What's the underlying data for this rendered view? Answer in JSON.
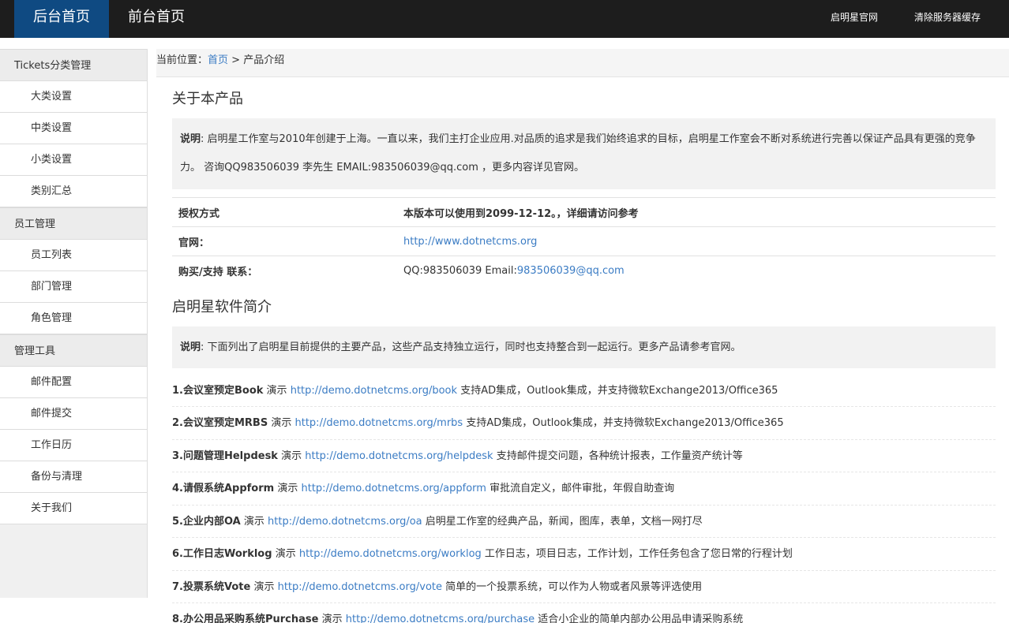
{
  "topbar": {
    "tabs": [
      {
        "label": "后台首页",
        "active": true
      },
      {
        "label": "前台首页",
        "active": false
      }
    ],
    "links": [
      {
        "label": "启明星官网"
      },
      {
        "label": "清除服务器缓存"
      }
    ]
  },
  "sidebar": {
    "groups": [
      {
        "title": "Tickets分类管理",
        "items": [
          "大类设置",
          "中类设置",
          "小类设置",
          "类别汇总"
        ]
      },
      {
        "title": "员工管理",
        "items": [
          "员工列表",
          "部门管理",
          "角色管理"
        ]
      },
      {
        "title": "管理工具",
        "items": [
          "邮件配置",
          "邮件提交",
          "工作日历",
          "备份与清理",
          "关于我们"
        ]
      }
    ]
  },
  "breadcrumb": {
    "prefix": "当前位置：",
    "home": "首页",
    "sep": " > ",
    "current": "产品介绍"
  },
  "about": {
    "title": "关于本产品",
    "note_label": "说明",
    "note_text": ": 启明星工作室与2010年创建于上海。一直以来，我们主打企业应用.对品质的追求是我们始终追求的目标，启明星工作室会不断对系统进行完善以保证产品具有更强的竞争力。 咨询QQ983506039 李先生 EMAIL:983506039@qq.com ，更多内容详见官网。"
  },
  "info": {
    "license_key": "授权方式",
    "license_value": "本版本可以使用到2099-12-12。，详细请访问参考",
    "site_key": "官网：",
    "site_value": "http://www.dotnetcms.org",
    "contact_key": "购买/支持 联系：",
    "contact_prefix": "QQ:983506039 Email:",
    "contact_email": "983506039@qq.com"
  },
  "intro": {
    "title": "启明星软件简介",
    "note_label": "说明",
    "note_text": ": 下面列出了启明星目前提供的主要产品，这些产品支持独立运行，同时也支持整合到一起运行。更多产品请参考官网。"
  },
  "demo_label": "演示",
  "products": [
    {
      "name": "1.会议室预定Book",
      "url": "http://demo.dotnetcms.org/book",
      "desc": "支持AD集成，Outlook集成，并支持微软Exchange2013/Office365"
    },
    {
      "name": "2.会议室预定MRBS",
      "url": "http://demo.dotnetcms.org/mrbs",
      "desc": "支持AD集成，Outlook集成，并支持微软Exchange2013/Office365"
    },
    {
      "name": "3.问题管理Helpdesk",
      "url": "http://demo.dotnetcms.org/helpdesk",
      "desc": "支持邮件提交问题，各种统计报表，工作量资产统计等"
    },
    {
      "name": "4.请假系统Appform",
      "url": "http://demo.dotnetcms.org/appform",
      "desc": "审批流自定义，邮件审批，年假自助查询"
    },
    {
      "name": "5.企业内部OA",
      "url": "http://demo.dotnetcms.org/oa",
      "desc": "启明星工作室的经典产品，新闻，图库，表单，文档一网打尽"
    },
    {
      "name": "6.工作日志Worklog",
      "url": "http://demo.dotnetcms.org/worklog",
      "desc": "工作日志，项目日志，工作计划，工作任务包含了您日常的行程计划"
    },
    {
      "name": "7.投票系统Vote",
      "url": "http://demo.dotnetcms.org/vote",
      "desc": "简单的一个投票系统，可以作为人物或者风景等评选使用"
    },
    {
      "name": "8.办公用品采购系统Purchase",
      "url": "http://demo.dotnetcms.org/purchase",
      "desc": "适合小企业的简单内部办公用品申请采购系统"
    }
  ]
}
